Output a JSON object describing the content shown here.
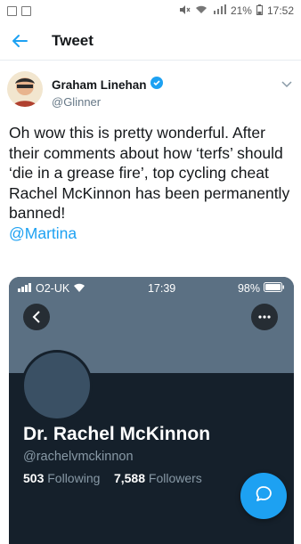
{
  "status_bar": {
    "battery_percent": "21%",
    "time": "17:52"
  },
  "header": {
    "title": "Tweet"
  },
  "tweet": {
    "author_name": "Graham Linehan",
    "author_handle": "@Glinner",
    "text": "Oh wow this is pretty wonderful. After their comments about how ‘terfs’ should ‘die in a grease fire’, top cycling cheat Rachel McKinnon has been permanently banned!",
    "mention": "@Martina"
  },
  "embedded_screenshot": {
    "carrier": "O2-UK",
    "time": "17:39",
    "battery": "98%",
    "profile_name": "Dr. Rachel McKinnon",
    "profile_handle": "@rachelvmckinnon",
    "following_count": "503",
    "following_label": "Following",
    "followers_count": "7,588",
    "followers_label": "Followers"
  },
  "colors": {
    "accent": "#1da1f2",
    "dark_bg": "#15202b",
    "banner": "#5b7083"
  }
}
